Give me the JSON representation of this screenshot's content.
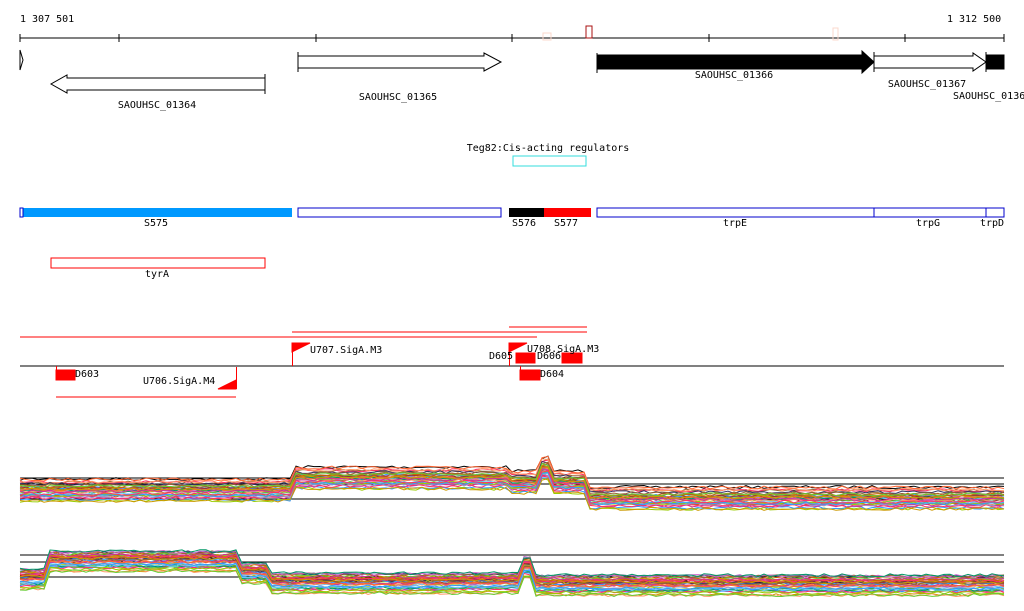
{
  "ruler": {
    "start": "1 307 501",
    "end": "1 312 500"
  },
  "genes": [
    "SAOUHSC_01364",
    "SAOUHSC_01365",
    "SAOUHSC_01366",
    "SAOUHSC_01367",
    "SAOUHSC_0136"
  ],
  "regulator": "Teg82:Cis-acting regulators",
  "segments": [
    "S575",
    "S576",
    "S577",
    "trpE",
    "trpG",
    "trpD"
  ],
  "operon": "tyrA",
  "features": {
    "u707": "U707.SigA.M3",
    "u708": "U708.SigA.M3",
    "u706": "U706.SigA.M4",
    "d605": "D605",
    "d606": "D606",
    "d604": "D604",
    "d603": "D603"
  },
  "colors": {
    "segment_blue": "#0099ff",
    "red": "#ff0000",
    "outline_blue": "#0000cc",
    "cyan": "#33dddd"
  }
}
